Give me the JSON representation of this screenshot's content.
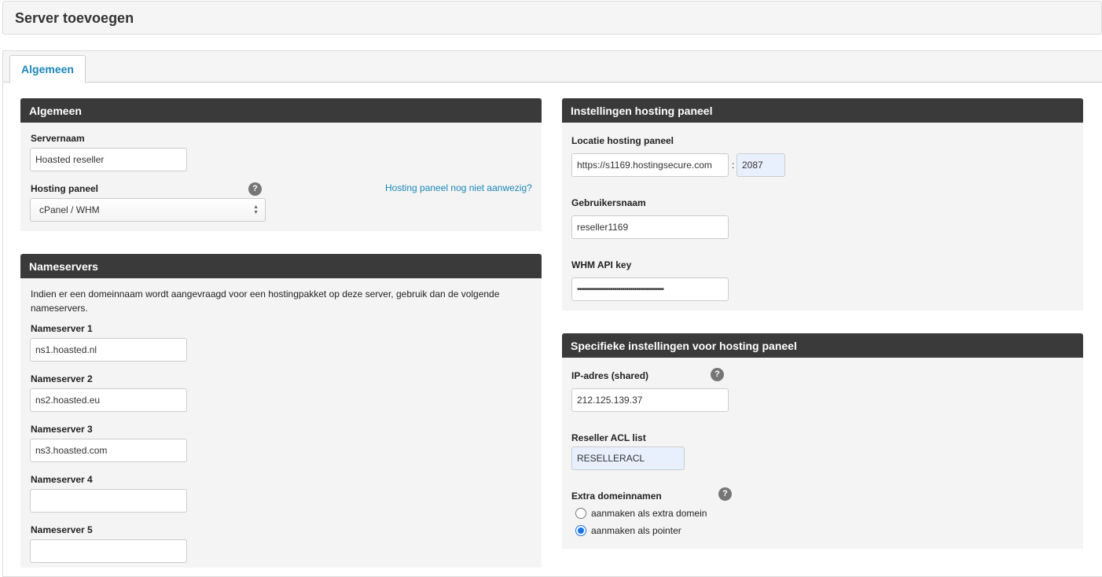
{
  "page": {
    "title": "Server toevoegen"
  },
  "tabs": [
    {
      "label": "Algemeen"
    }
  ],
  "general": {
    "title": "Algemeen",
    "servername_label": "Servernaam",
    "servername_value": "Hoasted reseller",
    "hosting_panel_label": "Hosting paneel",
    "hosting_panel_value": "cPanel / WHM",
    "missing_panel_link": "Hosting paneel nog niet aanwezig?",
    "help_glyph": "?"
  },
  "nameservers": {
    "title": "Nameservers",
    "description": "Indien er een domeinnaam wordt aangevraagd voor een hostingpakket op deze server, gebruik dan de volgende nameservers.",
    "items": [
      {
        "label": "Nameserver 1",
        "value": "ns1.hoasted.nl"
      },
      {
        "label": "Nameserver 2",
        "value": "ns2.hoasted.eu"
      },
      {
        "label": "Nameserver 3",
        "value": "ns3.hoasted.com"
      },
      {
        "label": "Nameserver 4",
        "value": ""
      },
      {
        "label": "Nameserver 5",
        "value": ""
      }
    ]
  },
  "panel_settings": {
    "title": "Instellingen hosting paneel",
    "location_label": "Locatie hosting paneel",
    "location_value": "https://s1169.hostingsecure.com",
    "port_separator": ":",
    "port_value": "2087",
    "username_label": "Gebruikersnaam",
    "username_value": "reseller1169",
    "api_key_label": "WHM API key",
    "api_key_value": "••••••••••••••••••••••••••••••••••••••••••••"
  },
  "specific_settings": {
    "title": "Specifieke instellingen voor hosting paneel",
    "ip_label": "IP-adres (shared)",
    "ip_value": "212.125.139.37",
    "acl_label": "Reseller ACL list",
    "acl_value": "RESELLERACL",
    "extra_domains_label": "Extra domeinnamen",
    "options": [
      {
        "label": "aanmaken als extra domein",
        "checked": false
      },
      {
        "label": "aanmaken als pointer",
        "checked": true
      }
    ],
    "help_glyph": "?"
  },
  "colors": {
    "accent": "#1a86b8",
    "panel_header": "#3a3a3a",
    "panel_bg": "#f4f4f4",
    "autofill_bg": "#e8f0fe"
  }
}
